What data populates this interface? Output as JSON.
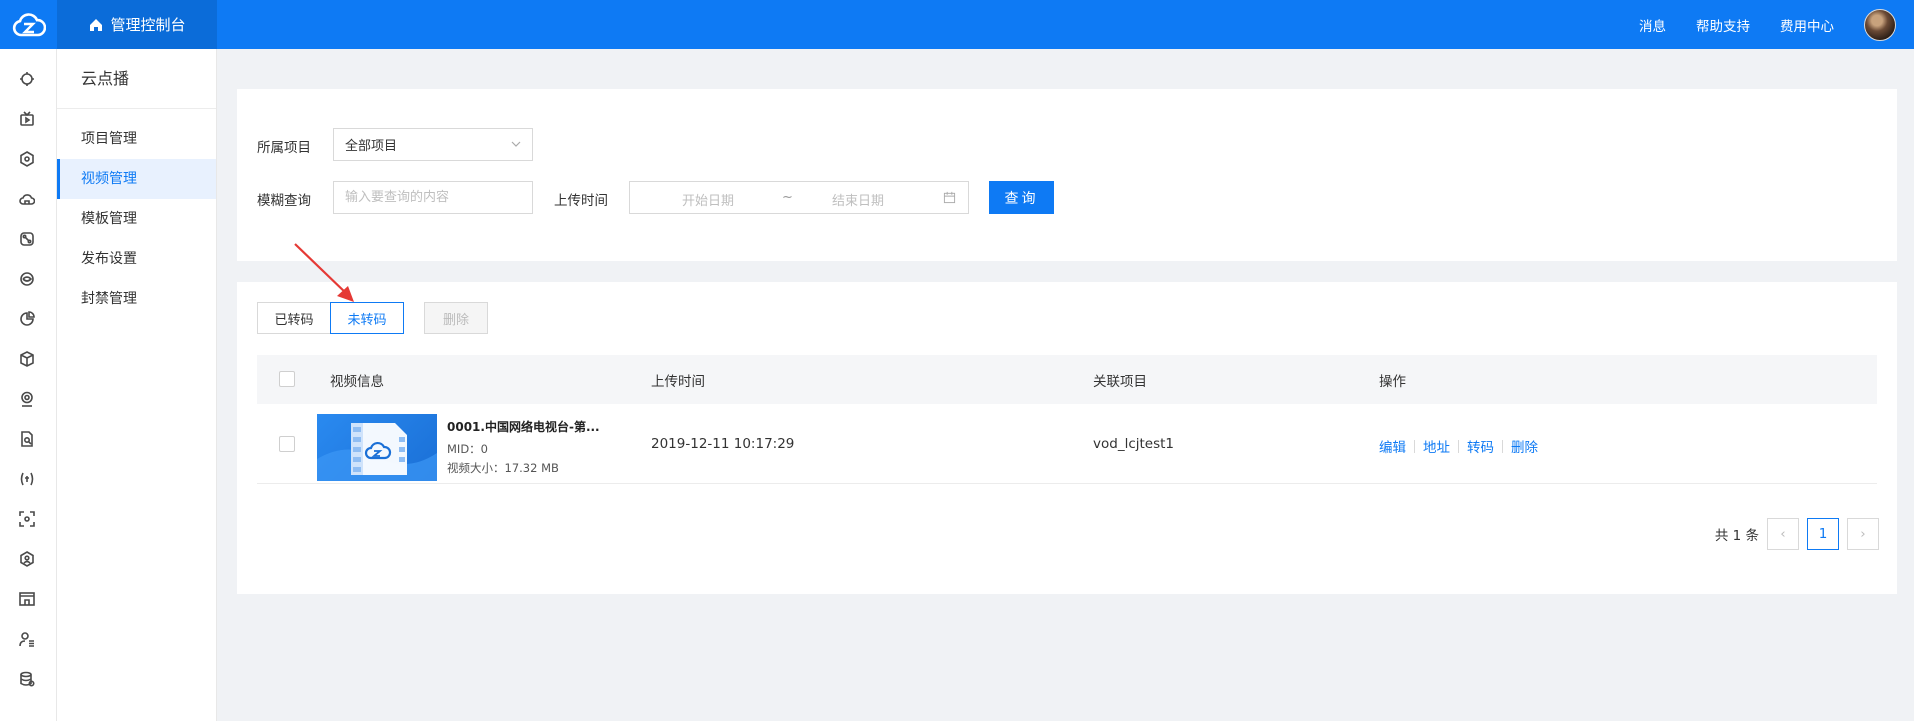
{
  "topbar": {
    "brand_label": "管理控制台",
    "links": [
      "消息",
      "帮助支持",
      "费用中心"
    ]
  },
  "rail": {
    "icons": [
      "cloud-cycle-icon",
      "tv-icon",
      "hexagon-icon",
      "cloud-home-icon",
      "network-icon",
      "eye-ring-icon",
      "pie-chart-icon",
      "cube-icon",
      "webcam-icon",
      "doc-search-icon",
      "bracket-signal-icon",
      "scan-icon",
      "hexagon-node-icon",
      "monitor-icon",
      "user-list-icon",
      "database-icon"
    ]
  },
  "sidebar": {
    "title": "云点播",
    "items": [
      {
        "label": "项目管理",
        "active": false
      },
      {
        "label": "视频管理",
        "active": true
      },
      {
        "label": "模板管理",
        "active": false
      },
      {
        "label": "发布设置",
        "active": false
      },
      {
        "label": "封禁管理",
        "active": false
      }
    ]
  },
  "filter": {
    "project_label": "所属项目",
    "project_value": "全部项目",
    "search_label": "模糊查询",
    "search_placeholder": "输入要查询的内容",
    "upload_time_label": "上传时间",
    "start_placeholder": "开始日期",
    "range_sep": "~",
    "end_placeholder": "结束日期",
    "query_button": "查询"
  },
  "list": {
    "tab_transcoded": "已转码",
    "tab_not_transcoded": "未转码",
    "delete_button": "删除",
    "columns": [
      "视频信息",
      "上传时间",
      "关联项目",
      "操作"
    ],
    "rows": [
      {
        "name": "0001.中国网络电视台-第...",
        "mid": "MID：0",
        "size": "视频大小：17.32 MB",
        "upload_time": "2019-12-11 10:17:29",
        "project": "vod_lcjtest1",
        "ops": [
          "编辑",
          "地址",
          "转码",
          "删除"
        ]
      }
    ],
    "total_text": "共 1 条",
    "current_page": "1",
    "prev_glyph": "‹",
    "next_glyph": "›"
  },
  "colors": {
    "primary": "#0e7af4",
    "annotation_arrow": "#e53935"
  }
}
